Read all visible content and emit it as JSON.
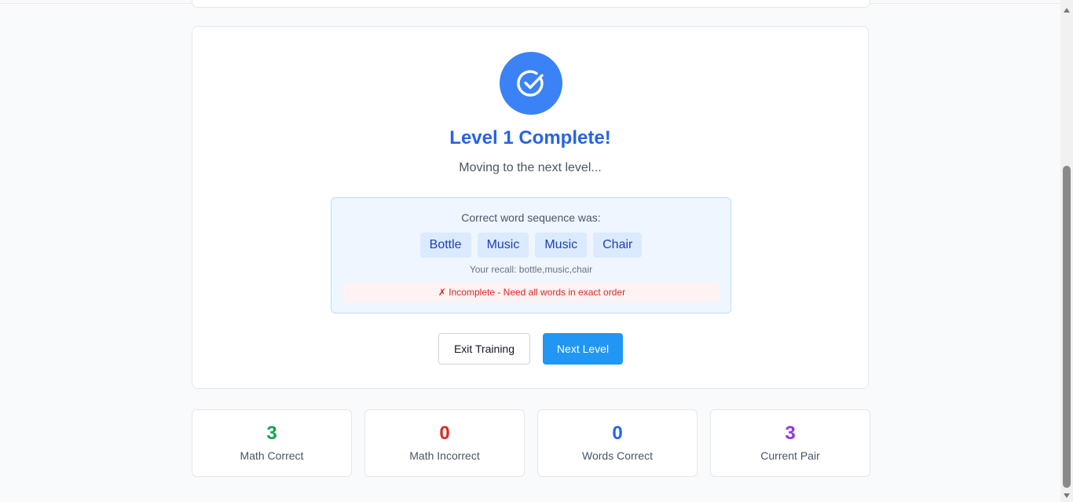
{
  "level": {
    "title": "Level 1 Complete!",
    "subtitle": "Moving to the next level..."
  },
  "sequence": {
    "label": "Correct word sequence was:",
    "words": [
      "Bottle",
      "Music",
      "Music",
      "Chair"
    ],
    "recall": "Your recall: bottle,music,chair",
    "result": "✗ Incomplete - Need all words in exact order"
  },
  "actions": {
    "exit_label": "Exit Training",
    "next_label": "Next Level"
  },
  "stats": [
    {
      "value": "3",
      "label": "Math Correct",
      "color": "#16a34a"
    },
    {
      "value": "0",
      "label": "Math Incorrect",
      "color": "#dc2626"
    },
    {
      "value": "0",
      "label": "Words Correct",
      "color": "#2563eb"
    },
    {
      "value": "3",
      "label": "Current Pair",
      "color": "#9333ea"
    }
  ],
  "icons": {
    "success": "check-circle-icon"
  },
  "colors": {
    "accent": "#3b82f6",
    "title": "#2563eb",
    "next_button": "#2196f3"
  }
}
